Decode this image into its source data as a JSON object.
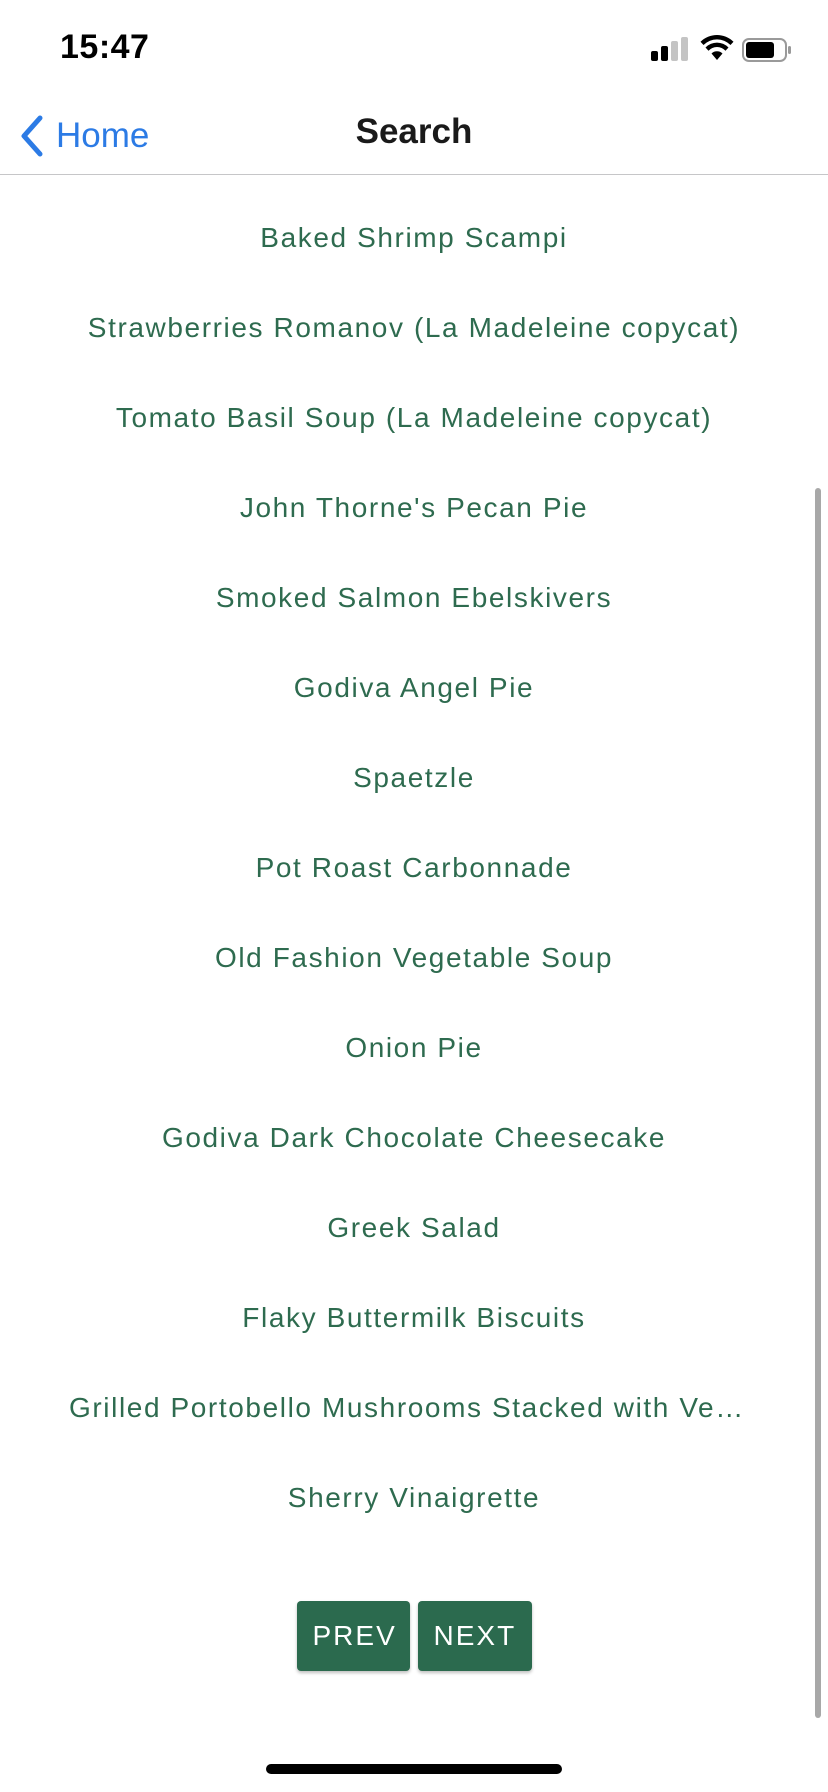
{
  "status_bar": {
    "time": "15:47",
    "icons": [
      "cellular-signal-icon",
      "wifi-icon",
      "battery-icon"
    ]
  },
  "nav": {
    "back_label": "Home",
    "back_icon": "chevron-left-icon",
    "title": "Search"
  },
  "recipes": [
    "Baked Shrimp Scampi",
    "Strawberries Romanov (La Madeleine copycat)",
    "Tomato Basil Soup (La Madeleine copycat)",
    "John Thorne's Pecan Pie",
    "Smoked Salmon Ebelskivers",
    "Godiva Angel Pie",
    "Spaetzle",
    "Pot Roast Carbonnade",
    "Old Fashion Vegetable Soup",
    "Onion Pie",
    "Godiva Dark Chocolate Cheesecake",
    "Greek Salad",
    "Flaky Buttermilk Biscuits",
    "Grilled Portobello Mushrooms Stacked with Vegetables",
    "Sherry Vinaigrette"
  ],
  "pagination": {
    "prev_label": "PREV",
    "next_label": "NEXT"
  },
  "colors": {
    "accent_blue": "#2c7be5",
    "recipe_text": "#2e6b4f",
    "button_bg": "#2b6a4e"
  }
}
